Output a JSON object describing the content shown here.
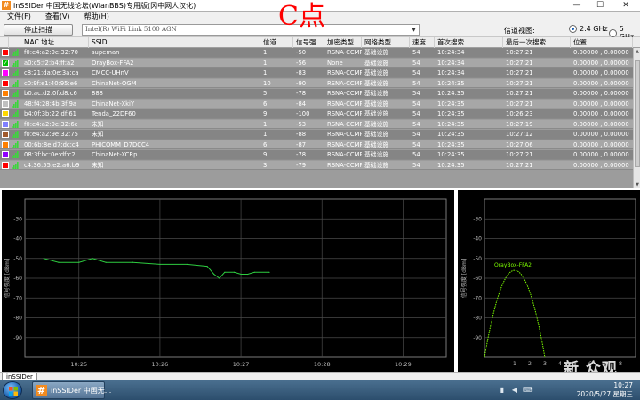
{
  "window": {
    "title": "inSSIDer 中国无线论坛(WlanBBS)专用版(冈中网人汉化)",
    "controls": {
      "minimize": "—",
      "maximize": "☐",
      "close": "✕"
    }
  },
  "overlay_text": "C点",
  "menu": [
    {
      "label": "文件(F)"
    },
    {
      "label": "查看(V)"
    },
    {
      "label": "帮助(H)"
    }
  ],
  "toolbar": {
    "scan_button": "停止扫描",
    "adapter": "Intel(R) WiFi Link 5100 AGN",
    "band_label": "信道视图:",
    "band_options": [
      {
        "label": "2.4 GHz",
        "selected": true
      },
      {
        "label": "5 GHz",
        "selected": false
      }
    ]
  },
  "table": {
    "columns": [
      "MAC 地址",
      "SSID",
      "信道",
      "信号强",
      "加密类型",
      "网络类型",
      "速度",
      "首次搜索",
      "最后一次搜索",
      "位置"
    ],
    "rows": [
      {
        "color": "#ff0000",
        "checked": false,
        "mac": "f0:e4:a2:9e:32:70",
        "ssid": "supeman",
        "channel": "1",
        "rssi": "-50",
        "security": "RSNA-CCMP",
        "network": "基础设施",
        "speed": "54",
        "first": "10:24:34",
        "last": "10:27:21",
        "location": "0.00000 , 0.00000"
      },
      {
        "color": "#00c000",
        "checked": true,
        "mac": "a0:c5:f2:b4:ff:a2",
        "ssid": "OrayBox-FFA2",
        "channel": "1",
        "rssi": "-56",
        "security": "None",
        "network": "基础设施",
        "speed": "54",
        "first": "10:24:34",
        "last": "10:27:21",
        "location": "0.00000 , 0.00000"
      },
      {
        "color": "#ff00ff",
        "checked": false,
        "mac": "c8:21:da:0e:3a:ca",
        "ssid": "CMCC-UHnV",
        "channel": "1",
        "rssi": "-83",
        "security": "RSNA-CCMP",
        "network": "基础设施",
        "speed": "54",
        "first": "10:24:34",
        "last": "10:27:21",
        "location": "0.00000 , 0.00000"
      },
      {
        "color": "#ff0000",
        "checked": false,
        "mac": "c0:9f:e1:40:95:e6",
        "ssid": "ChinaNet-OGM",
        "channel": "10",
        "rssi": "-90",
        "security": "RSNA-CCMP",
        "network": "基础设施",
        "speed": "54",
        "first": "10:24:35",
        "last": "10:27:21",
        "location": "0.00000 , 0.00000"
      },
      {
        "color": "#ff8000",
        "checked": false,
        "mac": "b0:ac:d2:0f:d8:c6",
        "ssid": "888",
        "channel": "5",
        "rssi": "-78",
        "security": "RSNA-CCMP",
        "network": "基础设施",
        "speed": "54",
        "first": "10:24:35",
        "last": "10:27:21",
        "location": "0.00000 , 0.00000"
      },
      {
        "color": "#c0c0c0",
        "checked": false,
        "mac": "48:f4:28:4b:3f:9a",
        "ssid": "ChinaNet-XkiY",
        "channel": "6",
        "rssi": "-84",
        "security": "RSNA-CCMP",
        "network": "基础设施",
        "speed": "54",
        "first": "10:24:35",
        "last": "10:27:21",
        "location": "0.00000 , 0.00000"
      },
      {
        "color": "#ffd700",
        "checked": false,
        "mac": "b4:0f:3b:22:df:61",
        "ssid": "Tenda_22DF60",
        "channel": "9",
        "rssi": "-100",
        "security": "RSNA-CCMP",
        "network": "基础设施",
        "speed": "54",
        "first": "10:24:35",
        "last": "10:26:23",
        "location": "0.00000 , 0.00000"
      },
      {
        "color": "#8080ff",
        "checked": false,
        "mac": "f0:e4:a2:9e:32:6c",
        "ssid": "未知",
        "channel": "1",
        "rssi": "-53",
        "security": "RSNA-CCMP",
        "network": "基础设施",
        "speed": "54",
        "first": "10:24:35",
        "last": "10:27:19",
        "location": "0.00000 , 0.00000"
      },
      {
        "color": "#a05a2c",
        "checked": false,
        "mac": "f0:e4:a2:9e:32:75",
        "ssid": "未知",
        "channel": "1",
        "rssi": "-88",
        "security": "RSNA-CCMP",
        "network": "基础设施",
        "speed": "54",
        "first": "10:24:35",
        "last": "10:27:12",
        "location": "0.00000 , 0.00000"
      },
      {
        "color": "#ff8000",
        "checked": false,
        "mac": "00:6b:8e:d7:dc:c4",
        "ssid": "PHICOMM_D7DCC4",
        "channel": "6",
        "rssi": "-87",
        "security": "RSNA-CCMP",
        "network": "基础设施",
        "speed": "54",
        "first": "10:24:35",
        "last": "10:27:06",
        "location": "0.00000 , 0.00000"
      },
      {
        "color": "#9000ff",
        "checked": false,
        "mac": "08:3f:bc:0e:df:c2",
        "ssid": "ChinaNet-XCRp",
        "channel": "9",
        "rssi": "-78",
        "security": "RSNA-CCMP",
        "network": "基础设施",
        "speed": "54",
        "first": "10:24:35",
        "last": "10:27:21",
        "location": "0.00000 , 0.00000"
      },
      {
        "color": "#ff0000",
        "checked": false,
        "mac": "c4:36:55:e2:a6:b9",
        "ssid": "未知",
        "channel": "3",
        "rssi": "-79",
        "security": "RSNA-CCMP",
        "network": "基础设施",
        "speed": "54",
        "first": "10:24:35",
        "last": "10:27:21",
        "location": "0.00000 , 0.00000"
      }
    ]
  },
  "chart_data": [
    {
      "type": "line",
      "ylabel": "信号强度 [dBm]",
      "ylim": [
        -100,
        -20
      ],
      "y_ticks": [
        "-30",
        "-40",
        "-50",
        "-60",
        "-70",
        "-80",
        "-90"
      ],
      "x_ticks": [
        "10:25",
        "10:26",
        "10:27",
        "10:28",
        "10:29"
      ],
      "grid": true,
      "series": [
        {
          "color": "#2ecc40",
          "x": [
            "10:24:34",
            "10:24:45",
            "10:25:00",
            "10:25:10",
            "10:25:20",
            "10:25:40",
            "10:26:00",
            "10:26:20",
            "10:26:35",
            "10:26:40",
            "10:26:44",
            "10:26:48",
            "10:26:55",
            "10:27:00",
            "10:27:05",
            "10:27:10",
            "10:27:21"
          ],
          "values": [
            -50,
            -52,
            -52,
            -50,
            -52,
            -52,
            -53,
            -53,
            -54,
            -58,
            -60,
            -57,
            -57,
            -58,
            -58,
            -57,
            -57
          ]
        }
      ]
    },
    {
      "type": "area",
      "ylabel": "信号强度 [dBm]",
      "ylim": [
        -100,
        -20
      ],
      "y_ticks": [
        "-30",
        "-40",
        "-50",
        "-60",
        "-70",
        "-80",
        "-90"
      ],
      "x_ticks": [
        "1",
        "2",
        "3",
        "4",
        "5",
        "6",
        "7",
        "8"
      ],
      "grid": true,
      "series": [
        {
          "name": "OrayBox-FFA2",
          "color": "#7cfc00",
          "channel": 1,
          "peak": -56
        }
      ]
    }
  ],
  "tabs": [
    {
      "label": "inSSIDer"
    }
  ],
  "taskbar": {
    "task_label": "inSSIDer 中国无...",
    "time": "10:27",
    "date": "2020/5/27 星期三",
    "tray_icons": [
      "network-icon",
      "volume-icon",
      "keyboard-icon"
    ]
  },
  "watermark": "新 众观"
}
